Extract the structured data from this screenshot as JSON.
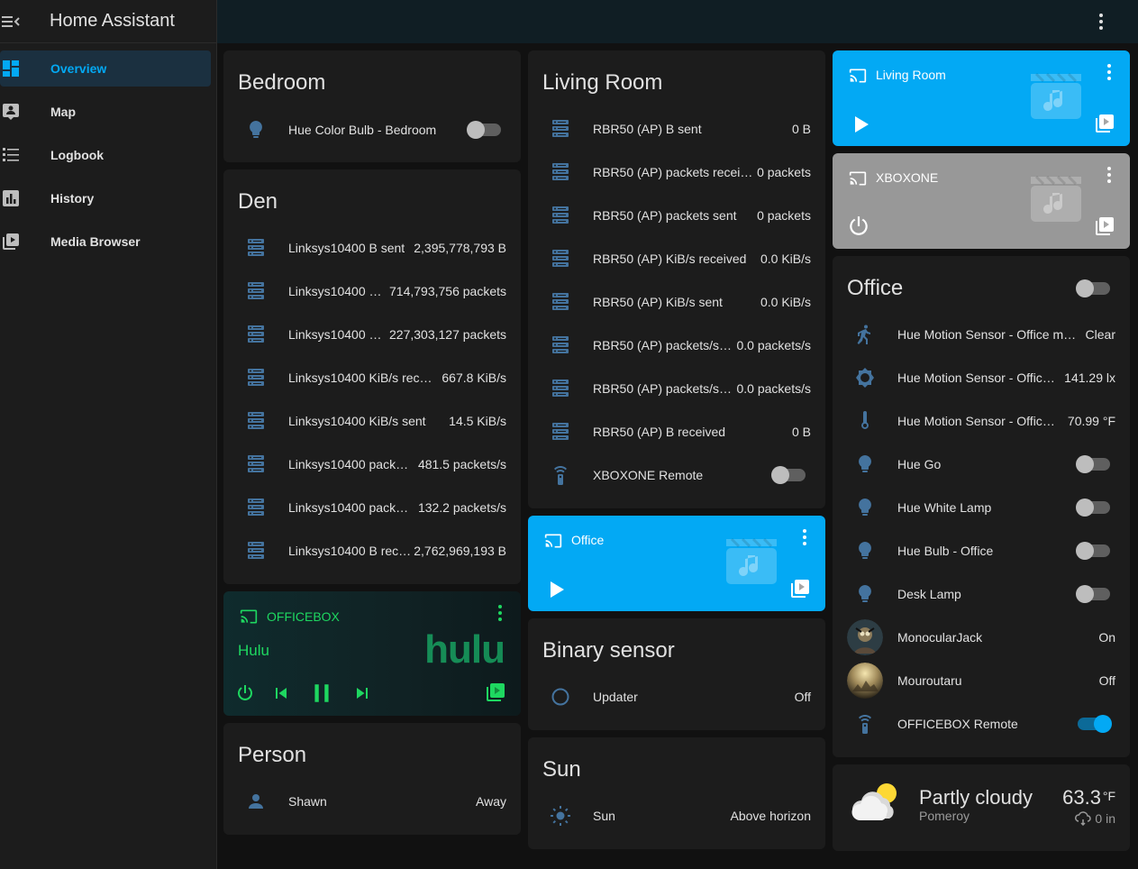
{
  "app": {
    "title": "Home Assistant"
  },
  "sidebar": {
    "items": [
      {
        "label": "Overview",
        "icon": "view-dashboard-icon",
        "active": true
      },
      {
        "label": "Map",
        "icon": "map-icon"
      },
      {
        "label": "Logbook",
        "icon": "logbook-icon"
      },
      {
        "label": "History",
        "icon": "history-chart-icon"
      },
      {
        "label": "Media Browser",
        "icon": "media-browser-icon"
      }
    ]
  },
  "colors": {
    "accent": "#03a9f4",
    "media_blue": "#03a9f4",
    "media_grey": "#989898",
    "officebox_green": "#1ed760",
    "hulu": "#1ce783"
  },
  "bedroom": {
    "title": "Bedroom",
    "rows": [
      {
        "name": "Hue Color Bulb - Bedroom",
        "icon": "lightbulb-icon",
        "state": "off"
      }
    ]
  },
  "den": {
    "title": "Den",
    "rows": [
      {
        "name": "Linksys10400 B sent",
        "value": "2,395,778,793 B"
      },
      {
        "name": "Linksys10400 …",
        "value": "714,793,756 packets"
      },
      {
        "name": "Linksys10400 …",
        "value": "227,303,127 packets"
      },
      {
        "name": "Linksys10400 KiB/s rec…",
        "value": "667.8 KiB/s"
      },
      {
        "name": "Linksys10400 KiB/s sent",
        "value": "14.5 KiB/s"
      },
      {
        "name": "Linksys10400 pack…",
        "value": "481.5 packets/s"
      },
      {
        "name": "Linksys10400 pack…",
        "value": "132.2 packets/s"
      },
      {
        "name": "Linksys10400 B rec…",
        "value": "2,762,969,193 B"
      }
    ]
  },
  "officebox": {
    "name": "OFFICEBOX",
    "app": "Hulu",
    "logo": "hulu"
  },
  "person": {
    "title": "Person",
    "rows": [
      {
        "name": "Shawn",
        "value": "Away"
      }
    ]
  },
  "living_room": {
    "title": "Living Room",
    "rows": [
      {
        "name": "RBR50 (AP) B sent",
        "value": "0 B"
      },
      {
        "name": "RBR50 (AP) packets recei…",
        "value": "0 packets"
      },
      {
        "name": "RBR50 (AP) packets sent",
        "value": "0 packets"
      },
      {
        "name": "RBR50 (AP) KiB/s received",
        "value": "0.0 KiB/s"
      },
      {
        "name": "RBR50 (AP) KiB/s sent",
        "value": "0.0 KiB/s"
      },
      {
        "name": "RBR50 (AP) packets/s…",
        "value": "0.0 packets/s"
      },
      {
        "name": "RBR50 (AP) packets/s…",
        "value": "0.0 packets/s"
      },
      {
        "name": "RBR50 (AP) B received",
        "value": "0 B"
      },
      {
        "name": "XBOXONE Remote",
        "state": "off"
      }
    ]
  },
  "media_office": {
    "name": "Office"
  },
  "media_living": {
    "name": "Living Room"
  },
  "media_xbox": {
    "name": "XBOXONE"
  },
  "binary_sensor": {
    "title": "Binary sensor",
    "rows": [
      {
        "name": "Updater",
        "value": "Off"
      }
    ]
  },
  "sun": {
    "title": "Sun",
    "rows": [
      {
        "name": "Sun",
        "value": "Above horizon"
      }
    ]
  },
  "office": {
    "title": "Office",
    "header_state": "off",
    "rows": [
      {
        "name": "Hue Motion Sensor - Office mo…",
        "value": "Clear",
        "icon": "walk-icon"
      },
      {
        "name": "Hue Motion Sensor - Office…",
        "value": "141.29 lx",
        "icon": "brightness-icon"
      },
      {
        "name": "Hue Motion Sensor - Office …",
        "value": "70.99 °F",
        "icon": "thermometer-icon"
      },
      {
        "name": "Hue Go",
        "state": "off",
        "icon": "lightbulb-icon"
      },
      {
        "name": "Hue White Lamp",
        "state": "off",
        "icon": "lightbulb-icon"
      },
      {
        "name": "Hue Bulb - Office",
        "state": "off",
        "icon": "lightbulb-icon"
      },
      {
        "name": "Desk Lamp",
        "state": "off",
        "icon": "lightbulb-icon"
      },
      {
        "name": "MonocularJack",
        "value": "On",
        "icon": "avatar"
      },
      {
        "name": "Mouroutaru",
        "value": "Off",
        "icon": "avatar"
      },
      {
        "name": "OFFICEBOX Remote",
        "state": "on",
        "icon": "remote-icon"
      }
    ]
  },
  "weather": {
    "condition": "Partly cloudy",
    "location": "Pomeroy",
    "temperature": "63.3",
    "unit": "°F",
    "precipitation": "0 in"
  }
}
